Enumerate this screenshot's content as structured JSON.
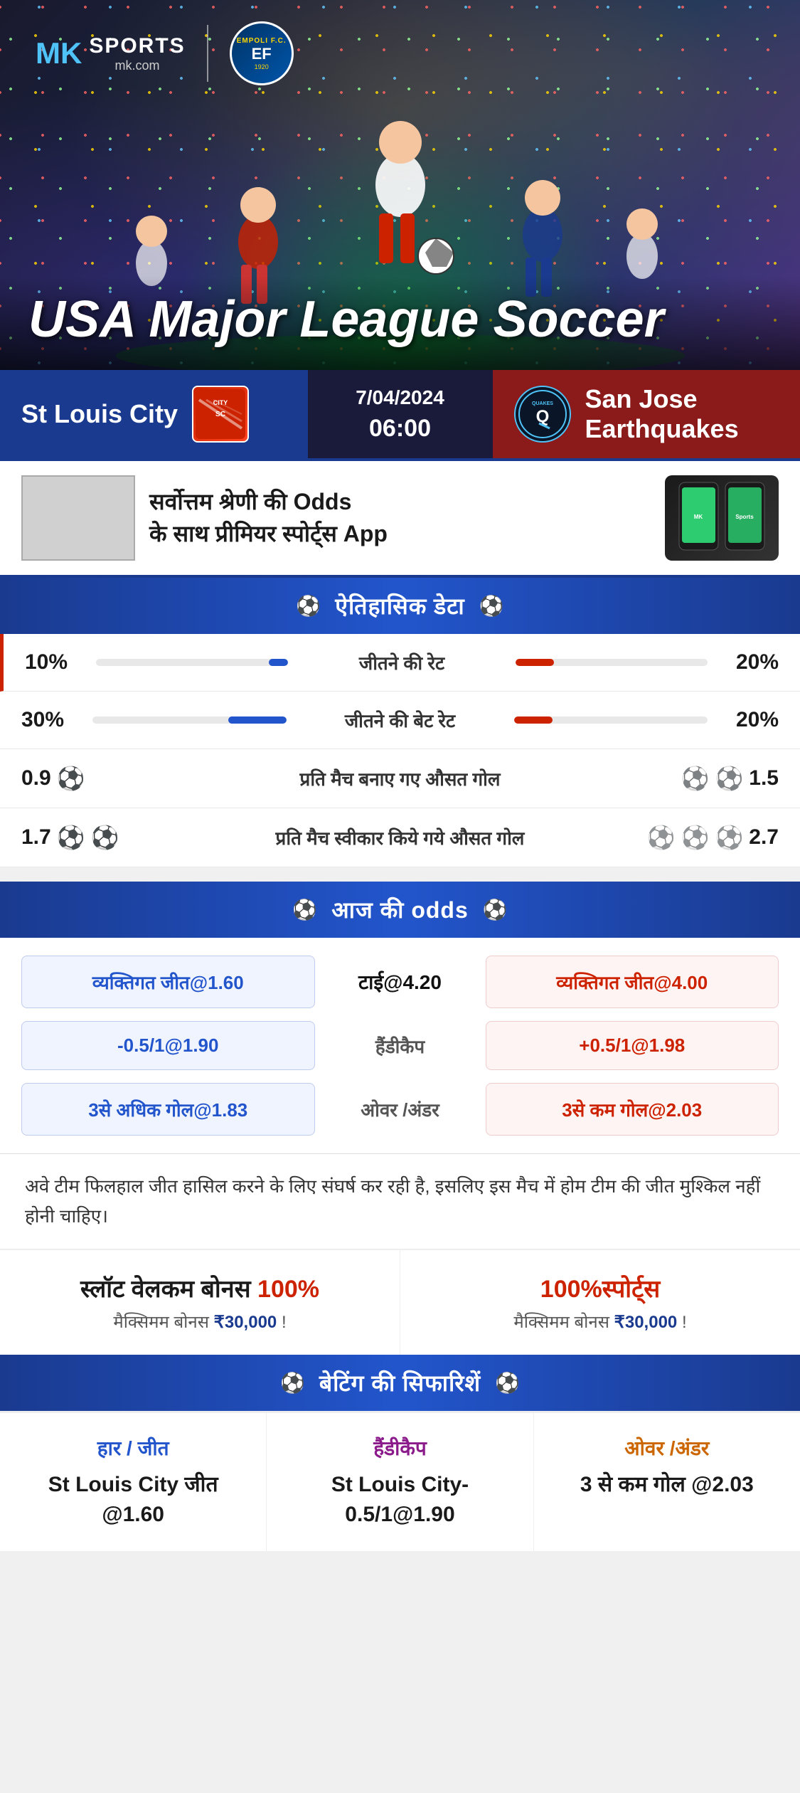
{
  "brand": {
    "mk": "MK",
    "sports": "SPORTS",
    "mkcom": "mk.com",
    "divider": "|"
  },
  "empoli": {
    "top_text": "EMPOLI F.C.",
    "fc": "EF",
    "year": "1920"
  },
  "hero": {
    "title": "USA Major League Soccer"
  },
  "match": {
    "team_left": "St Louis City",
    "team_right": "San Jose Earthquakes",
    "team_right_abbr": "QUAKES",
    "date": "7/04/2024",
    "time": "06:00"
  },
  "promo": {
    "text_part1": "सर्वोत्तम श्रेणी की ",
    "text_odds": "Odds",
    "text_part2": " के साथ प्रीमियर स्पोर्ट्स ",
    "text_app": "App"
  },
  "historical": {
    "section_title": "ऐतिहासिक डेटा",
    "stats": [
      {
        "label": "जीतने की रेट",
        "left_val": "10%",
        "right_val": "20%",
        "left_pct": 10,
        "right_pct": 20
      },
      {
        "label": "जीतने की बेट रेट",
        "left_val": "30%",
        "right_val": "20%",
        "left_pct": 30,
        "right_pct": 20
      }
    ],
    "icon_stats": [
      {
        "label": "प्रति मैच बनाए गए औसत गोल",
        "left_val": "0.9",
        "right_val": "1.5",
        "left_balls": 1,
        "right_balls": 2
      },
      {
        "label": "प्रति मैच स्वीकार किये गये औसत गोल",
        "left_val": "1.7",
        "right_val": "2.7",
        "left_balls": 2,
        "right_balls": 3
      }
    ]
  },
  "odds": {
    "section_title": "आज की odds",
    "row1": {
      "left": "व्यक्तिगत जीत@1.60",
      "center_label": "टाई@4.20",
      "right": "व्यक्तिगत जीत@4.00"
    },
    "row2": {
      "left": "-0.5/1@1.90",
      "center_label": "हैंडीकैप",
      "right": "+0.5/1@1.98"
    },
    "row3": {
      "left": "3से अधिक गोल@1.83",
      "center_label": "ओवर /अंडर",
      "right": "3से कम गोल@2.03"
    }
  },
  "info_text": "अवे टीम फिलहाल जीत हासिल करने के लिए संघर्ष कर रही है, इसलिए इस मैच में होम टीम की जीत मुश्किल नहीं होनी चाहिए।",
  "bonus": {
    "left": {
      "main": "स्लॉट वेलकम बोनस 100%",
      "sub": "मैक्सिमम बोनस ₹30,000  !"
    },
    "right": {
      "main": "100%स्पोर्ट्स",
      "sub": "मैक्सिमम बोनस  ₹30,000 !"
    }
  },
  "betting_reco": {
    "section_title": "बेटिंग की सिफारिशें",
    "cols": [
      {
        "type": "हार / जीत",
        "type_class": "win",
        "value": "St Louis City जीत @1.60"
      },
      {
        "type": "हैंडीकैप",
        "type_class": "handicap",
        "value": "St Louis City-0.5/1@1.90"
      },
      {
        "type": "ओवर /अंडर",
        "type_class": "over",
        "value": "3 से कम गोल @2.03"
      }
    ]
  }
}
